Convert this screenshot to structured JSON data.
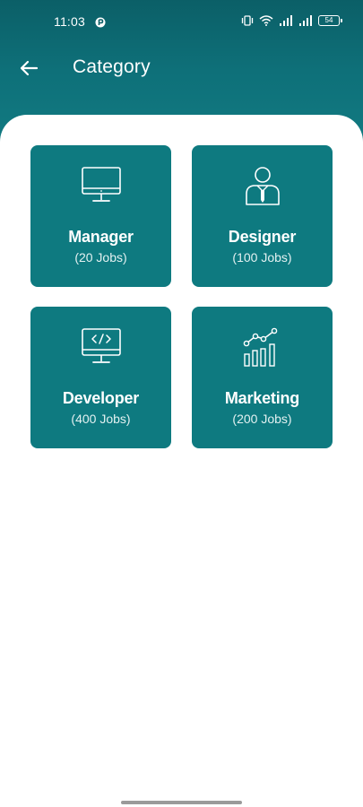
{
  "status_bar": {
    "time": "11:03",
    "battery": "54",
    "icons": [
      "app-notification-icon",
      "vibrate-icon",
      "wifi-icon",
      "signal-icon",
      "signal-icon",
      "battery-icon"
    ]
  },
  "app_bar": {
    "title": "Category",
    "back_icon": "arrow-left-icon"
  },
  "categories": [
    {
      "title": "Manager",
      "count": "(20 Jobs)",
      "icon": "monitor-icon"
    },
    {
      "title": "Designer",
      "count": "(100 Jobs)",
      "icon": "person-tie-icon"
    },
    {
      "title": "Developer",
      "count": "(400 Jobs)",
      "icon": "code-monitor-icon"
    },
    {
      "title": "Marketing",
      "count": "(200 Jobs)",
      "icon": "growth-chart-icon"
    }
  ],
  "colors": {
    "header_top": "#0b5f67",
    "header_bottom": "#127c83",
    "card": "#0e7a80",
    "background": "#ffffff",
    "text_on_primary": "#ffffff"
  }
}
